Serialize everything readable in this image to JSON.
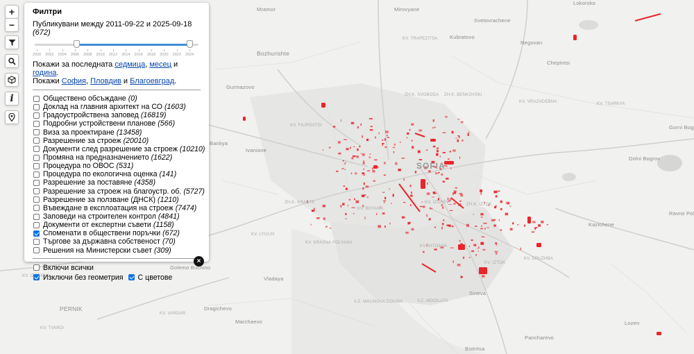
{
  "map": {
    "places": [
      {
        "name": "Mramor",
        "cls": "place"
      },
      {
        "name": "Mirovyane",
        "cls": "place"
      },
      {
        "name": "Lokorsko",
        "cls": "place"
      },
      {
        "name": "Svetovrachene",
        "cls": "place"
      },
      {
        "name": "Kubratovo",
        "cls": "place"
      },
      {
        "name": "Negovan",
        "cls": "place"
      },
      {
        "name": "Chepintsi",
        "cls": "place"
      },
      {
        "name": "Bozhurishte",
        "cls": "place town"
      },
      {
        "name": "Gurmazovo",
        "cls": "place"
      },
      {
        "name": "Ivaniane",
        "cls": "place"
      },
      {
        "name": "Bankya",
        "cls": "place"
      },
      {
        "name": "SOFIA",
        "cls": "place city"
      },
      {
        "name": "Gorni Bogrov",
        "cls": "place"
      },
      {
        "name": "Dolni Bogrov",
        "cls": "place"
      },
      {
        "name": "Ravno Pole",
        "cls": "place"
      },
      {
        "name": "Kazichene",
        "cls": "place"
      },
      {
        "name": "Vladaya",
        "cls": "place"
      },
      {
        "name": "Golemo Buchino",
        "cls": "place"
      },
      {
        "name": "PERNIK",
        "cls": "place town"
      },
      {
        "name": "Dragichevo",
        "cls": "place"
      },
      {
        "name": "Marchaevo",
        "cls": "place"
      },
      {
        "name": "Bistritsa",
        "cls": "place"
      },
      {
        "name": "Pancharevo",
        "cls": "place"
      },
      {
        "name": "Lozen",
        "cls": "place"
      },
      {
        "name": "Sineva",
        "cls": "place"
      }
    ],
    "districts": [
      "KV. TRAPEZITSA",
      "ZH.K. SVOBODA",
      "ZH.K. BENKOVSKI",
      "KV. VRAZHDEBNA",
      "KV. FILIPOVTSI",
      "KV. LYULIN",
      "KV. KRASNA POLYANA",
      "ZH.K. KRASTE",
      "ZH.K. IZTOK",
      "KV. VITOSHA",
      "KV. BOYANA",
      "V.Z. MALINOVA DOLINA",
      "V.Z. MOGILATA",
      "KV. DRUZHBA",
      "KV. IZGREV",
      "KV. IZTOK",
      "KV. TSARKVA",
      "KV. VARDAR",
      "KV. IZGREV 2",
      "KV. TVARDI"
    ],
    "feature_color": "#e8252a"
  },
  "toolbar": {
    "zoom_in": "+",
    "zoom_out": "−",
    "info_label": "i"
  },
  "panel": {
    "title": "Филтри",
    "range_prefix": "Публикувани между 2011-09-22 и 2025-09-18",
    "range_count": "(672)",
    "slider_start": 0.265,
    "slider_end": 0.985,
    "years": [
      "2010",
      "2012",
      "2014",
      "2016",
      "2018",
      "2020",
      "2022",
      "2024",
      "2000",
      "2002",
      "2004",
      "2006",
      "2008"
    ],
    "year_ticks": [
      "2000",
      "2002",
      "2004",
      "2006",
      "2008",
      "2010",
      "2012",
      "2014",
      "2016",
      "2018",
      "2020",
      "2022",
      "2024"
    ],
    "shortcut_line1_prefix": "Покажи за последната",
    "shortcut_week": "седмица",
    "shortcut_month": "месец",
    "shortcut_and": "и",
    "shortcut_year": "година",
    "shortcut_line2_prefix": "Покажи",
    "shortcut_sofia": "София",
    "shortcut_plovdiv": "Пловдив",
    "shortcut_and2": "и",
    "shortcut_blagoevgrad": "Благоевград",
    "categories": [
      {
        "label": "Обществено обсъждане",
        "count": "(0)",
        "checked": false
      },
      {
        "label": "Доклад на главния архитект на СО",
        "count": "(1603)",
        "checked": false
      },
      {
        "label": "Градоустройствена заповед",
        "count": "(16819)",
        "checked": false
      },
      {
        "label": "Подробни устройствени планове",
        "count": "(566)",
        "checked": false
      },
      {
        "label": "Виза за проектиране",
        "count": "(13458)",
        "checked": false
      },
      {
        "label": "Разрешение за строеж",
        "count": "(20010)",
        "checked": false
      },
      {
        "label": "Документи след разрешение за строеж",
        "count": "(10210)",
        "checked": false
      },
      {
        "label": "Промяна на предназначението",
        "count": "(1622)",
        "checked": false
      },
      {
        "label": "Процедура по ОВОС",
        "count": "(531)",
        "checked": false
      },
      {
        "label": "Процедура по екологична оценка",
        "count": "(141)",
        "checked": false
      },
      {
        "label": "Разрешение за поставяне",
        "count": "(4358)",
        "checked": false
      },
      {
        "label": "Разрешение за строеж на благоустр. об.",
        "count": "(5727)",
        "checked": false
      },
      {
        "label": "Разрешение за ползване (ДНСК)",
        "count": "(1210)",
        "checked": false
      },
      {
        "label": "Въвеждане в експлоатация на строеж",
        "count": "(7474)",
        "checked": false
      },
      {
        "label": "Заповеди на строителен контрол",
        "count": "(4841)",
        "checked": false
      },
      {
        "label": "Документи от експертни съвети",
        "count": "(1158)",
        "checked": false
      },
      {
        "label": "Споменати в обществени поръчки",
        "count": "(672)",
        "checked": true
      },
      {
        "label": "Търгове за държавна собственост",
        "count": "(70)",
        "checked": false
      },
      {
        "label": "Решения на Министерски съвет",
        "count": "(309)",
        "checked": false
      }
    ],
    "include_all": "Включи всички",
    "exclude_no_geometry": "Изключи без геометрия",
    "with_colors": "С цветове",
    "include_all_checked": false,
    "exclude_no_geometry_checked": true,
    "with_colors_checked": true,
    "close_glyph": "×"
  }
}
